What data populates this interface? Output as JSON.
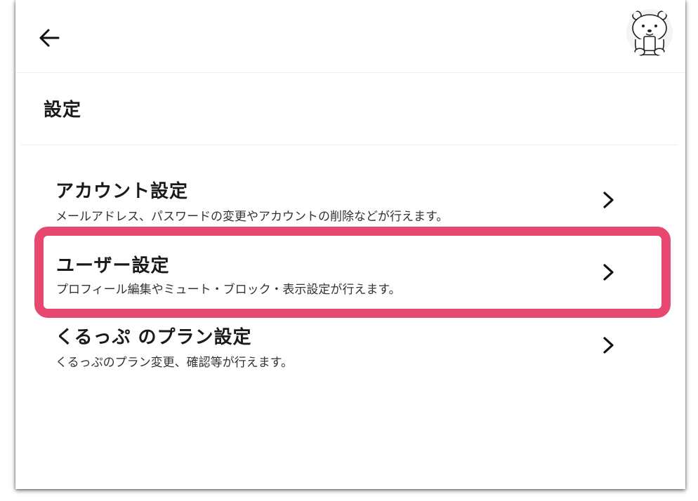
{
  "header": {
    "back_icon": "arrow-left-icon",
    "avatar_icon": "bear-avatar-icon"
  },
  "page": {
    "title": "設定"
  },
  "menu": {
    "items": [
      {
        "title": "アカウント設定",
        "description": "メールアドレス、パスワードの変更やアカウントの削除などが行えます。",
        "icon": "chevron-right-icon"
      },
      {
        "title": "ユーザー設定",
        "description": "プロフィール編集やミュート・ブロック・表示設定が行えます。",
        "icon": "chevron-right-icon",
        "highlighted": true
      },
      {
        "title": "くるっぷ のプラン設定",
        "description": "くるっぷのプラン変更、確認等が行えます。",
        "icon": "chevron-right-icon"
      }
    ]
  },
  "colors": {
    "highlight": "#e8486f",
    "text": "#1a1a1a"
  }
}
